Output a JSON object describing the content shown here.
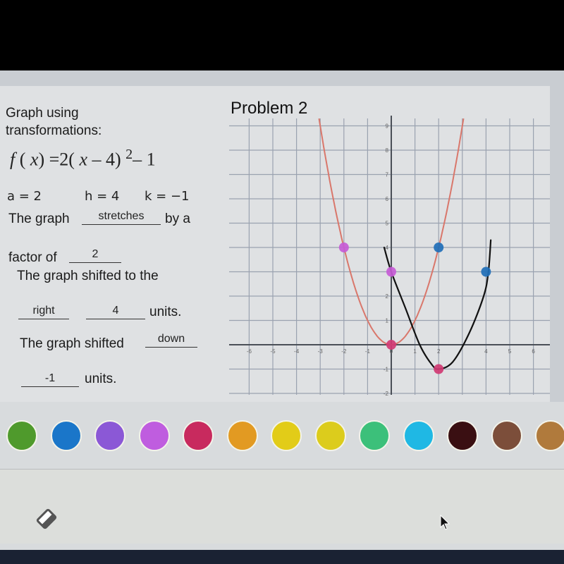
{
  "problem": {
    "title": "Problem 2",
    "heading_line1": "Graph using",
    "heading_line2": "transformations:",
    "formula": {
      "f": "f",
      "x1": "x",
      "eq": " =2( ",
      "x2": "x",
      "rest": "– 4)",
      "exp": "2",
      "tail": "– 1"
    },
    "params": {
      "a": "a = 2",
      "h": "h = 4",
      "k": "k = −1"
    },
    "sentences": {
      "s1_prefix": "The graph",
      "s1_blank": "stretches",
      "s1_suffix": "by a",
      "s2_prefix": "factor of",
      "s2_blank": "2",
      "s3": "The graph shifted to the",
      "s4_blank1": "right",
      "s4_blank2": "4",
      "s4_suffix": "units.",
      "s5_prefix": "The graph shifted",
      "s5_blank": "down",
      "s6_blank": "-1",
      "s6_suffix": "units."
    }
  },
  "chart_data": {
    "type": "scatter",
    "title": "Problem 2",
    "xlim": [
      -6.5,
      6.5
    ],
    "ylim": [
      -2,
      9
    ],
    "x_ticks": [
      -6,
      -5,
      -4,
      -3,
      -2,
      -1,
      0,
      1,
      2,
      4,
      5,
      6
    ],
    "x_tick_labels": [
      "-6",
      "-5",
      "-4",
      "-3",
      "-2",
      "-1",
      "0",
      "1",
      "2",
      "4",
      "5",
      "6"
    ],
    "y_ticks": [
      9,
      8,
      7,
      6,
      5,
      4,
      2,
      1,
      -1,
      -2
    ],
    "y_tick_labels": [
      "9",
      "8",
      "7",
      "6",
      "5",
      "4",
      "2",
      "1",
      "-1",
      "-2"
    ],
    "grid": true,
    "parent_curve": {
      "name": "y = x^2",
      "color": "#d9776b",
      "a": 1,
      "h": 0,
      "k": 0
    },
    "sketch_curve": {
      "name": "hand-drawn sketch",
      "color": "#111111",
      "points": [
        [
          -0.3,
          4.0
        ],
        [
          0.0,
          3.0
        ],
        [
          0.6,
          1.5
        ],
        [
          1.2,
          0.0
        ],
        [
          1.7,
          -0.8
        ],
        [
          2.0,
          -1.0
        ],
        [
          2.6,
          -0.7
        ],
        [
          3.3,
          0.5
        ],
        [
          3.9,
          2.0
        ],
        [
          4.1,
          3.0
        ],
        [
          4.2,
          4.3
        ]
      ]
    },
    "points": [
      {
        "x": -2,
        "y": 4,
        "color": "#c65bd6"
      },
      {
        "x": 0,
        "y": 3,
        "color": "#c65bd6"
      },
      {
        "x": 0,
        "y": 0,
        "color": "#d03a73"
      },
      {
        "x": 2,
        "y": -1,
        "color": "#d03a73"
      },
      {
        "x": 2,
        "y": 4,
        "color": "#1f6fb8"
      },
      {
        "x": 4,
        "y": 3,
        "color": "#1f6fb8"
      }
    ]
  },
  "palette": [
    {
      "name": "green",
      "color": "#4f9a2c"
    },
    {
      "name": "blue",
      "color": "#1a76c9"
    },
    {
      "name": "purple",
      "color": "#8b58d6"
    },
    {
      "name": "violet",
      "color": "#bf5ddf"
    },
    {
      "name": "crimson",
      "color": "#c82a5e"
    },
    {
      "name": "orange",
      "color": "#e29a22"
    },
    {
      "name": "yellow",
      "color": "#e2cc18"
    },
    {
      "name": "yellow-2",
      "color": "#dccc1c"
    },
    {
      "name": "teal-green",
      "color": "#3cc07a"
    },
    {
      "name": "sky-blue",
      "color": "#1fb8e4"
    },
    {
      "name": "dark-brown",
      "color": "#3a0f12"
    },
    {
      "name": "brown",
      "color": "#7c4e3a"
    },
    {
      "name": "tan",
      "color": "#b07a3c"
    }
  ],
  "tools": {
    "eraser": "eraser-icon"
  }
}
